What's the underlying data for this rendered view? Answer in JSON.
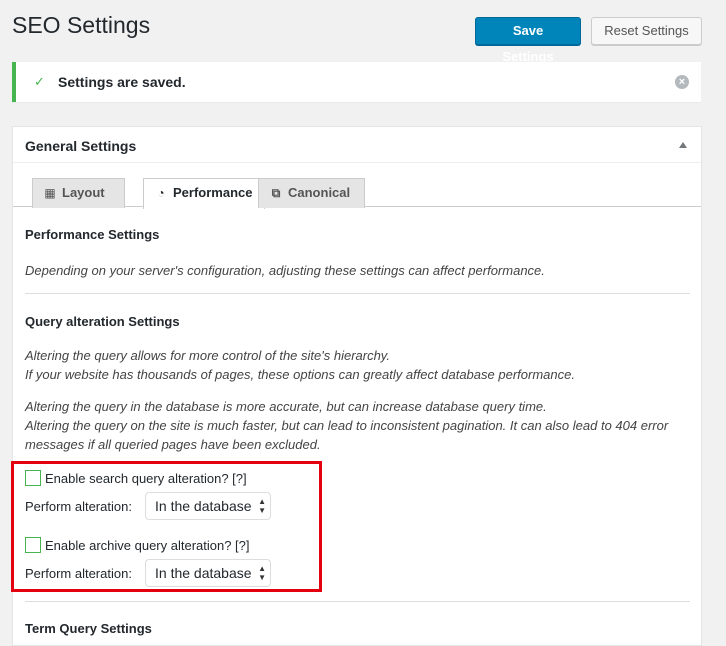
{
  "page": {
    "title": "SEO Settings"
  },
  "toolbar": {
    "save_label": "Save Settings",
    "reset_label": "Reset Settings"
  },
  "notice": {
    "check": "✓",
    "message": "Settings are saved.",
    "dismiss": "×"
  },
  "panel": {
    "title": "General Settings",
    "tabs": [
      {
        "label": "Layout",
        "icon": "layout-grid-icon",
        "glyph": "▦"
      },
      {
        "label": "Performance",
        "icon": "dashboard-gauge-icon",
        "glyph": "◔"
      },
      {
        "label": "Canonical",
        "icon": "external-link-icon",
        "glyph": "⧉"
      }
    ],
    "active_tab": "Performance"
  },
  "performance": {
    "heading": "Performance Settings",
    "description": "Depending on your server's configuration, adjusting these settings can affect performance."
  },
  "query": {
    "heading": "Query alteration Settings",
    "desc1_line1": "Altering the query allows for more control of the site's hierarchy.",
    "desc1_line2": "If your website has thousands of pages, these options can greatly affect database performance.",
    "desc2_line1": "Altering the query in the database is more accurate, but can increase database query time.",
    "desc2_line2": "Altering the query on the site is much faster, but can lead to inconsistent pagination. It can also lead to 404 error messages if all queried pages have been excluded.",
    "search_checkbox_label": "Enable search query alteration? [?]",
    "search_checked": false,
    "search_perform_label": "Perform alteration:",
    "search_select_value": "In the database",
    "archive_checkbox_label": "Enable archive query alteration? [?]",
    "archive_checked": false,
    "archive_perform_label": "Perform alteration:",
    "archive_select_value": "In the database"
  },
  "next_section": {
    "heading": "Term Query Settings"
  },
  "colors": {
    "primary": "#0085ba",
    "success": "#46b450",
    "highlight": "#e3000f"
  }
}
